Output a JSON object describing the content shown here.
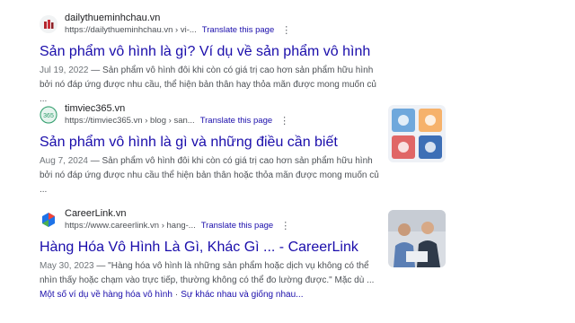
{
  "results": [
    {
      "site_name": "dailythueminhchau.vn",
      "url": "https://dailythueminhchau.vn › vi-...",
      "translate": "Translate this page",
      "title": "Sản phẩm vô hình là gì? Ví dụ về sản phẩm vô hình",
      "date": "Jul 19, 2022",
      "snippet": " — Sản phẩm vô hình đôi khi còn có giá trị cao hơn sản phẩm hữu hình bởi nó đáp ứng được nhu cầu, thể hiện bản thân hay thỏa mãn được mong muốn củ ...",
      "favicon": "building-favicon-icon"
    },
    {
      "site_name": "timviec365.vn",
      "url": "https://timviec365.vn › blog › san...",
      "translate": "Translate this page",
      "title": "Sản phẩm vô hình là gì và những điều cần biết",
      "date": "Aug 7, 2024",
      "snippet": " — Sản phẩm vô hình đôi khi còn có giá trị cao hơn sản phẩm hữu hình bởi nó đáp ứng được nhu cầu thể hiện bản thân hoặc thỏa mãn được mong muốn củ ...",
      "favicon": "timviec365-logo-icon",
      "favicon_text": "365"
    },
    {
      "site_name": "CareerLink.vn",
      "url": "https://www.careerlink.vn › hang-...",
      "translate": "Translate this page",
      "title": "Hàng Hóa Vô Hình Là Gì, Khác Gì ... - CareerLink",
      "date": "May 30, 2023",
      "snippet": " — \"Hàng hóa vô hình là những sản phẩm hoặc dịch vụ không có thể nhìn thấy hoặc chạm vào trực tiếp, thường không có thể đo lường được.\" Mặc dù ...",
      "favicon": "careerlink-logo-icon",
      "sitelinks": [
        "Một số ví dụ về hàng hóa vô hình",
        "Sự khác nhau và giống nhau..."
      ]
    }
  ],
  "colors": {
    "link": "#1a0dab",
    "snippet": "#4d5156",
    "date": "#70757a"
  }
}
